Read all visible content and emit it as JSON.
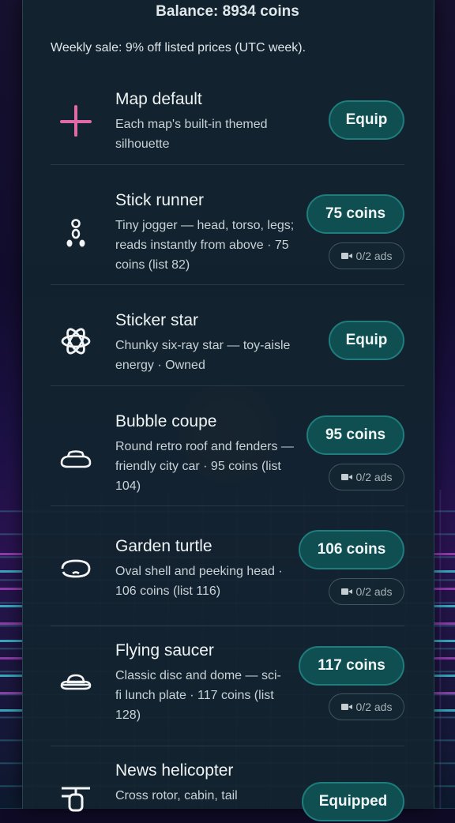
{
  "header": {
    "balance": "Balance: 8934 coins",
    "sale": "Weekly sale: 9% off listed prices (UTC week)."
  },
  "colors": {
    "accent": "#0f4f52",
    "accent_border": "#1f7d7d",
    "panel": "#12242e"
  },
  "items": [
    {
      "icon": "crosshair-icon",
      "title": "Map default",
      "desc": "Each map's built-in themed silhouette",
      "button": "Equip",
      "ads": ""
    },
    {
      "icon": "stick-runner-icon",
      "title": "Stick runner",
      "desc": "Tiny jogger — head, torso, legs; reads instantly from above · 75 coins (list 82)",
      "button": "75 coins",
      "ads": "0/2 ads"
    },
    {
      "icon": "sticker-star-icon",
      "title": "Sticker star",
      "desc": "Chunky six-ray star — toy-aisle energy · Owned",
      "button": "Equip",
      "ads": ""
    },
    {
      "icon": "bubble-coupe-icon",
      "title": "Bubble coupe",
      "desc": "Round retro roof and fenders — friendly city car · 95 coins (list 104)",
      "button": "95 coins",
      "ads": "0/2 ads"
    },
    {
      "icon": "garden-turtle-icon",
      "title": "Garden turtle",
      "desc": "Oval shell and peeking head · 106 coins (list 116)",
      "button": "106 coins",
      "ads": "0/2 ads"
    },
    {
      "icon": "flying-saucer-icon",
      "title": "Flying saucer",
      "desc": "Classic disc and dome — sci-fi lunch plate · 117 coins (list 128)",
      "button": "117 coins",
      "ads": "0/2 ads"
    },
    {
      "icon": "helicopter-icon",
      "title": "News helicopter",
      "desc": "Cross rotor, cabin, tail",
      "button": "Equipped",
      "ads": ""
    }
  ]
}
